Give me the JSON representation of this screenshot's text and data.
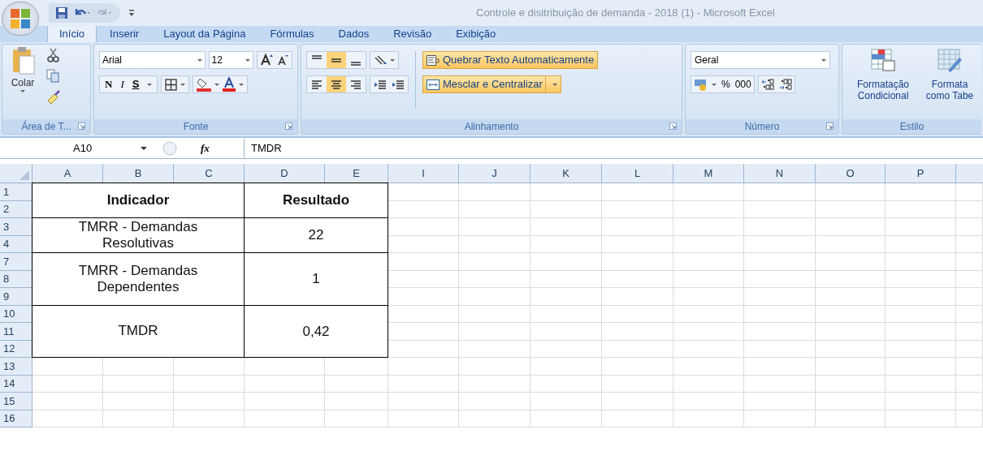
{
  "window": {
    "title": "Controle e disitribuição de demanda - 2018 (1) - Microsoft Excel"
  },
  "tabs": [
    {
      "label": "Início",
      "selected": true
    },
    {
      "label": "Inserir",
      "selected": false
    },
    {
      "label": "Layout da Página",
      "selected": false
    },
    {
      "label": "Fórmulas",
      "selected": false
    },
    {
      "label": "Dados",
      "selected": false
    },
    {
      "label": "Revisão",
      "selected": false
    },
    {
      "label": "Exibição",
      "selected": false
    }
  ],
  "ribbon": {
    "clipboard": {
      "label": "Área de T...",
      "paste": "Colar"
    },
    "font": {
      "label": "Fonte",
      "font_name": "Arial",
      "font_size": "12",
      "bold": "N",
      "italic": "I",
      "underline": "S"
    },
    "alignment": {
      "label": "Alinhamento",
      "vertical": [
        {
          "on": false
        },
        {
          "on": true
        },
        {
          "on": false
        }
      ],
      "horizontal": [
        {
          "on": false
        },
        {
          "on": true
        },
        {
          "on": false
        }
      ],
      "wrap_text": {
        "label": "Quebrar Texto Automaticamente",
        "on": true
      },
      "merge": {
        "label": "Mesclar e Centralizar",
        "on": true
      }
    },
    "number": {
      "label": "Número",
      "format": "Geral",
      "percent": "%",
      "thousands": "000"
    },
    "style": {
      "label": "Estilo",
      "buttons": [
        {
          "line1": "Formatação",
          "line2": "Condicional"
        },
        {
          "line1": "Formata",
          "line2": "como Tabe"
        }
      ]
    }
  },
  "formula_bar": {
    "name_box": "A10",
    "function_label": "fx",
    "formula": "TMDR"
  },
  "columns": [
    "A",
    "B",
    "C",
    "D",
    "E",
    "I",
    "J",
    "K",
    "L",
    "M",
    "N",
    "O",
    "P"
  ],
  "rows": [
    "1",
    "2",
    "3",
    "4",
    "7",
    "8",
    "9",
    "10",
    "11",
    "12",
    "13",
    "14",
    "15",
    "16"
  ],
  "table": [
    {
      "indicator": "Indicador",
      "result": "Resultado",
      "header": true
    },
    {
      "indicator": "TMRR - Demandas Resolutivas",
      "result": "22",
      "header": false
    },
    {
      "indicator": "TMRR - Demandas Dependentes",
      "result": "1",
      "header": false
    },
    {
      "indicator": "TMDR",
      "result": "0,42",
      "header": false
    }
  ]
}
